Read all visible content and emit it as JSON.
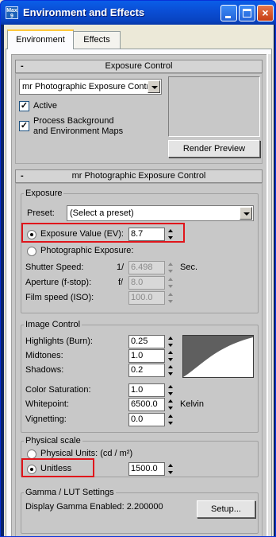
{
  "window": {
    "icon_text": "Max 9",
    "title": "Environment and Effects",
    "minimize": "_",
    "close": "×"
  },
  "tabs": [
    {
      "label": "Environment",
      "active": true
    },
    {
      "label": "Effects",
      "active": false
    }
  ],
  "exposure_control_rollout": {
    "header": "Exposure Control",
    "collapse_symbol": "-",
    "selected_control": "mr Photographic Exposure Contro",
    "active_label": "Active",
    "active_checked": "✓",
    "process_bg_label_1": "Process Background",
    "process_bg_label_2": "and Environment Maps",
    "process_bg_checked": "✓",
    "render_preview_label": "Render Preview"
  },
  "mr_rollout": {
    "header": "mr Photographic Exposure Control",
    "collapse_symbol": "-",
    "exposure_group": {
      "title": "Exposure",
      "preset_label": "Preset:",
      "preset_value": "(Select a preset)",
      "ev_label": "Exposure Value (EV):",
      "ev_value": "8.7",
      "photo_exposure_label": "Photographic Exposure:",
      "shutter_label": "Shutter Speed:",
      "shutter_prefix": "1/",
      "shutter_value": "6.498",
      "shutter_unit": "Sec.",
      "aperture_label": "Aperture (f-stop):",
      "aperture_prefix": "f/",
      "aperture_value": "8.0",
      "film_label": "Film speed (ISO):",
      "film_value": "100.0"
    },
    "image_control_group": {
      "title": "Image Control",
      "highlights_label": "Highlights (Burn):",
      "highlights_value": "0.25",
      "midtones_label": "Midtones:",
      "midtones_value": "1.0",
      "shadows_label": "Shadows:",
      "shadows_value": "0.2",
      "saturation_label": "Color Saturation:",
      "saturation_value": "1.0",
      "whitepoint_label": "Whitepoint:",
      "whitepoint_value": "6500.0",
      "whitepoint_unit": "Kelvin",
      "vignetting_label": "Vignetting:",
      "vignetting_value": "0.0"
    },
    "physical_scale_group": {
      "title": "Physical scale",
      "physical_units_label": "Physical Units: (cd / m²)",
      "unitless_label": "Unitless",
      "unitless_value": "1500.0"
    },
    "gamma_group": {
      "title": "Gamma / LUT Settings",
      "status_text": "Display Gamma Enabled:  2.200000",
      "setup_label": "Setup..."
    }
  },
  "colors": {
    "highlight_border": "#e0151b",
    "titlebar": "#0a4fd6",
    "panel_bg": "#c8c8c8"
  }
}
